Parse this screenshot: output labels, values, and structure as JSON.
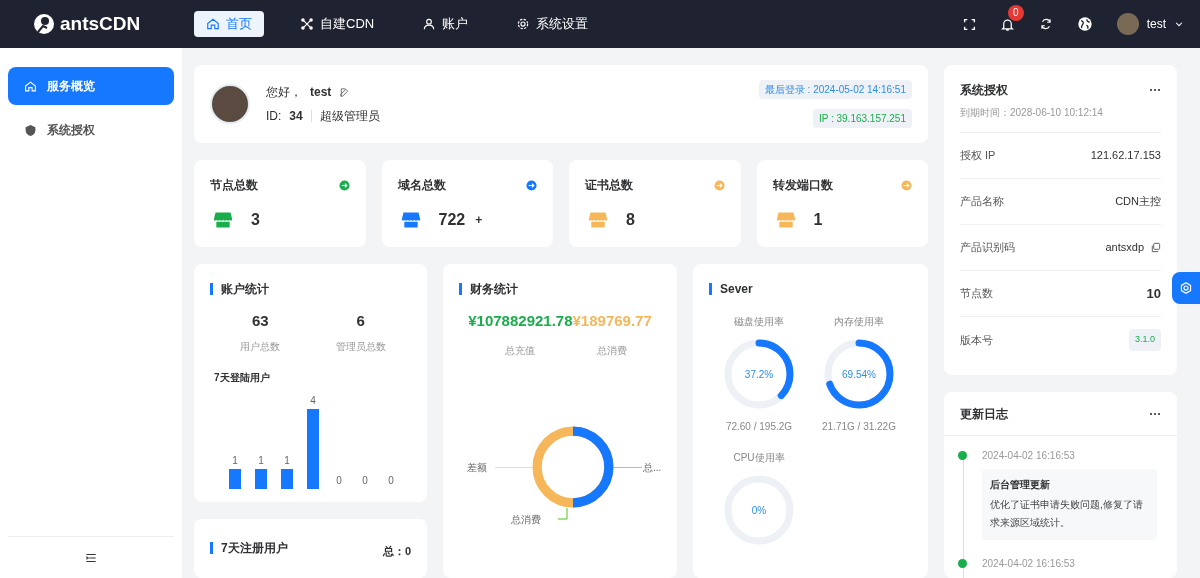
{
  "header": {
    "logo": "antsCDN",
    "nav": [
      {
        "label": "首页",
        "selected": true
      },
      {
        "label": "自建CDN",
        "selected": false
      },
      {
        "label": "账户",
        "selected": false
      },
      {
        "label": "系统设置",
        "selected": false
      }
    ],
    "notification_count": "0",
    "user": "test"
  },
  "sidebar": {
    "items": [
      {
        "label": "服务概览",
        "selected": true
      },
      {
        "label": "系统授权",
        "selected": false
      }
    ]
  },
  "profile": {
    "greeting": "您好，",
    "name": "test",
    "id_label": "ID:",
    "id": "34",
    "role": "超级管理员",
    "last_login": "最后登录 : 2024-05-02 14:16:51",
    "ip": "IP : 39.163.157.251"
  },
  "stats": [
    {
      "label": "节点总数",
      "value": "3",
      "color": "#1aad4b"
    },
    {
      "label": "域名总数",
      "value": "722",
      "suffix": "+",
      "color": "#1677ff"
    },
    {
      "label": "证书总数",
      "value": "8",
      "color": "#f5b75a"
    },
    {
      "label": "转发端口数",
      "value": "1",
      "color": "#f5b75a"
    }
  ],
  "account_stats": {
    "title": "账户统计",
    "figures": [
      {
        "value": "63",
        "label": "用户总数"
      },
      {
        "value": "6",
        "label": "管理员总数"
      }
    ],
    "chart_title": "7天登陆用户",
    "bar_labels": [
      "1",
      "1",
      "1",
      "4",
      "0",
      "0",
      "0"
    ]
  },
  "register": {
    "title": "7天注册用户",
    "total": "总：0"
  },
  "finance": {
    "title": "财务统计",
    "figures": [
      {
        "value": "¥107882921.78",
        "label": "总充值",
        "color": "#1aad4b"
      },
      {
        "value": "¥189769.77",
        "label": "总消费",
        "color": "#f5b75a"
      }
    ],
    "donut_labels": [
      "差额",
      "总消费",
      "总..."
    ]
  },
  "server": {
    "title": "Sever",
    "meters": [
      {
        "label": "磁盘使用率",
        "level": 0.372,
        "reading": "37.2%",
        "detail": "72.60 / 195.2G"
      },
      {
        "label": "内存使用率",
        "level": 0.6954,
        "reading": "69.54%",
        "detail": "21.71G / 31.22G"
      },
      {
        "label": "CPU使用率",
        "level": 0,
        "reading": "0%"
      }
    ]
  },
  "license": {
    "title": "系统授权",
    "expiry": "到期时间：2028-06-10 10:12:14",
    "rows": [
      {
        "label": "授权 IP",
        "value": "121.62.17.153",
        "kind": "plain"
      },
      {
        "label": "产品名称",
        "value": "CDN主控",
        "kind": "plain"
      },
      {
        "label": "产品识别码",
        "value": "antsxdp",
        "kind": "copy"
      },
      {
        "label": "节点数",
        "value": "10",
        "kind": "bold"
      },
      {
        "label": "版本号",
        "value": "3.1.0",
        "kind": "tag"
      }
    ]
  },
  "changelog": {
    "title": "更新日志",
    "entries": [
      {
        "time": "2024-04-02 16:16:53",
        "title": "后台管理更新",
        "text": "优化了证书申请失败问题,修复了请求来源区域统计。"
      },
      {
        "time": "2024-04-02 16:16:53"
      }
    ]
  }
}
